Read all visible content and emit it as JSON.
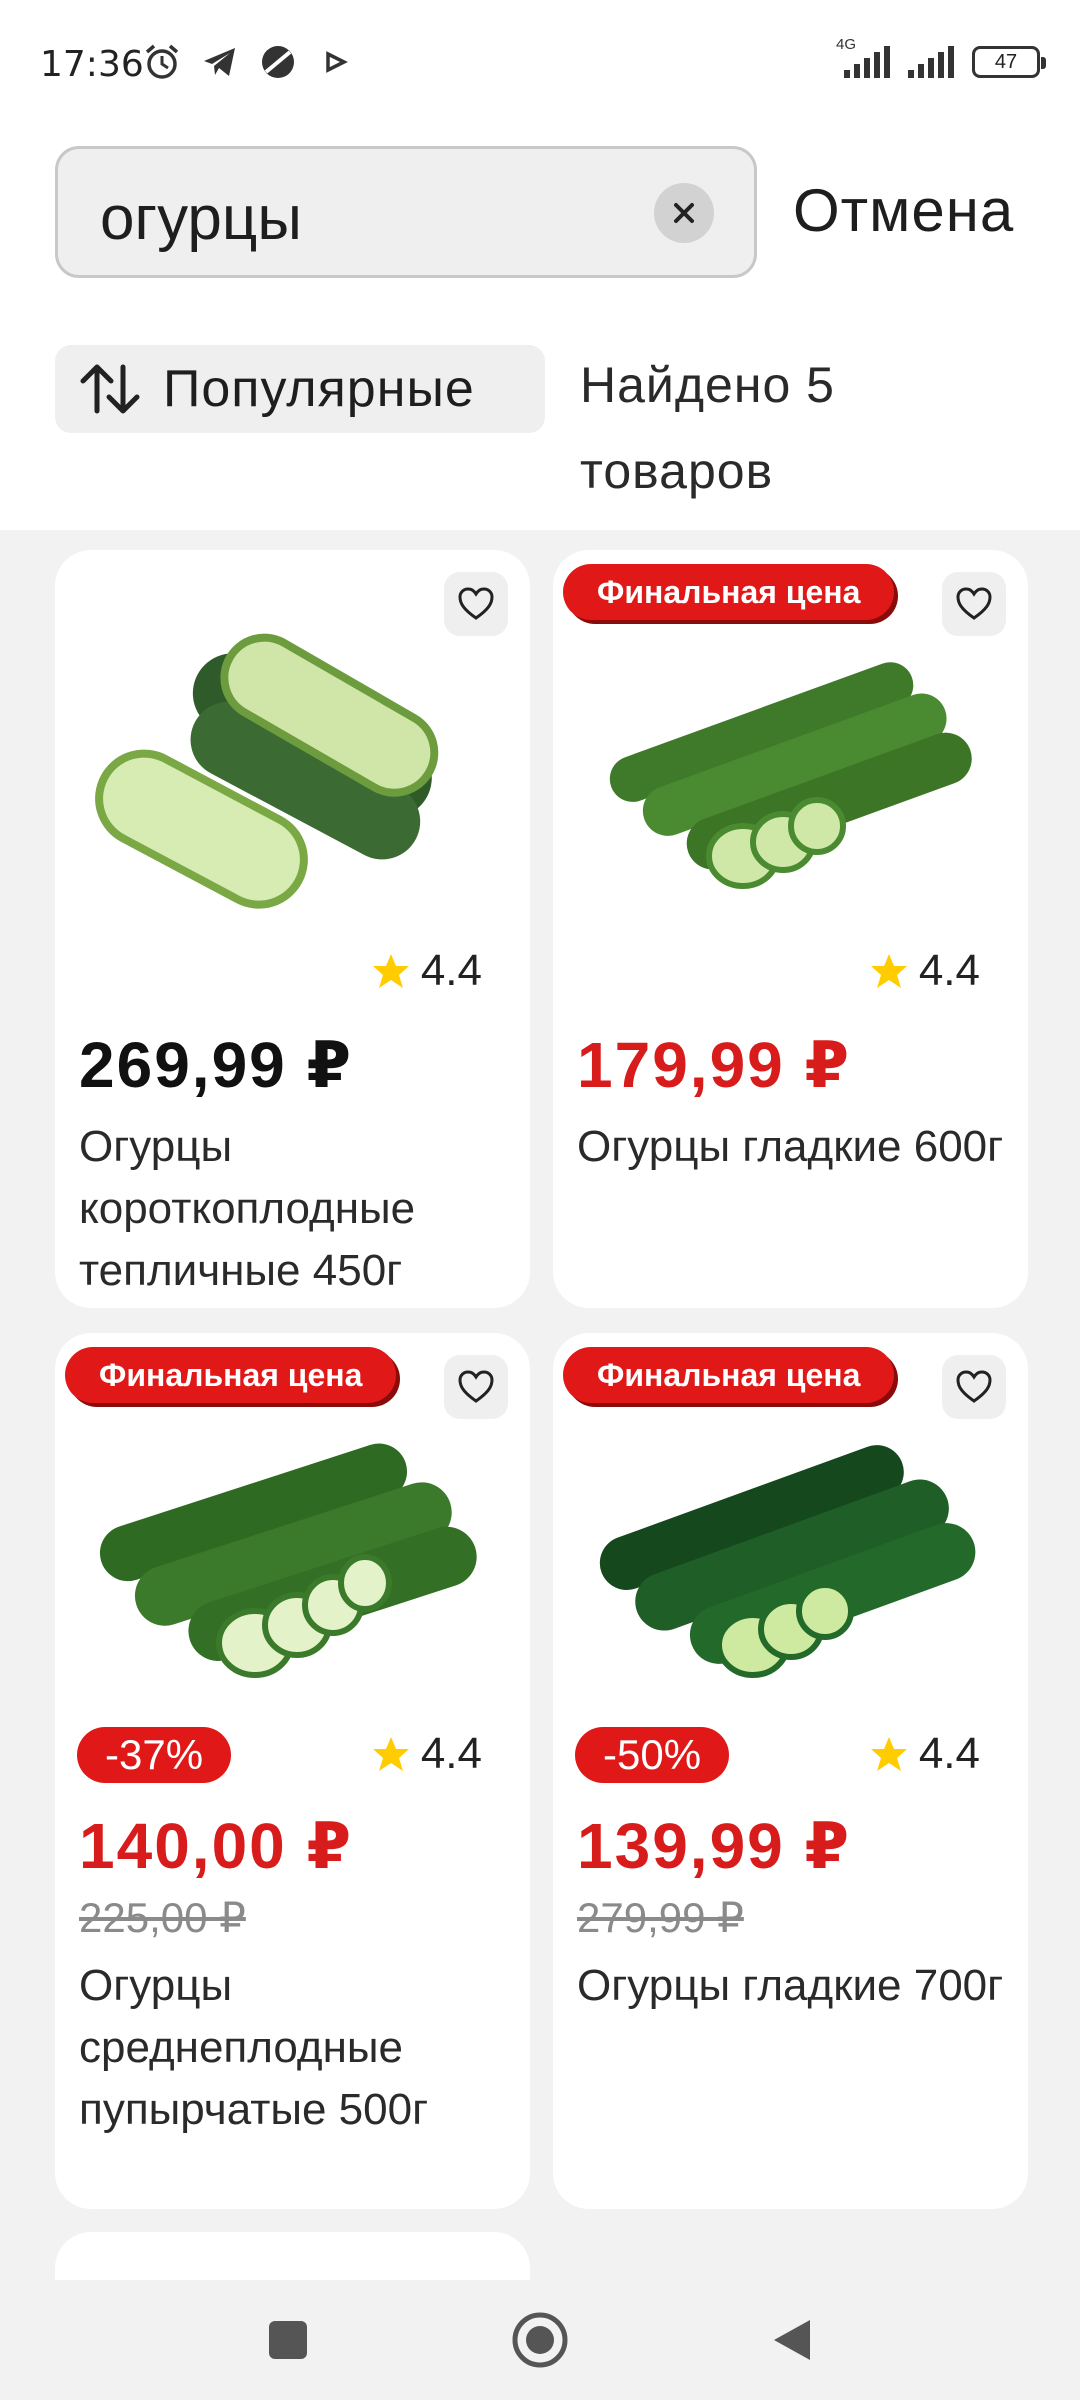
{
  "status_bar": {
    "time": "17:36",
    "network": "4G",
    "battery": "47",
    "icons": [
      "alarm-icon",
      "telegram-icon",
      "app-icon",
      "play-icon"
    ]
  },
  "search": {
    "query": "огурцы",
    "cancel_label": "Отмена"
  },
  "sort": {
    "label": "Популярные",
    "icon": "sort-arrows-icon"
  },
  "results": {
    "found_text": "Найдено 5 товаров"
  },
  "colors": {
    "accent_red": "#e01818",
    "price_red": "#d81c1c",
    "star_yellow": "#ffcc00"
  },
  "products": [
    {
      "name": "Огурцы короткоплодные тепличные 450г",
      "price": "269,99 ₽",
      "rating": "4.4",
      "badge": "",
      "discount": "",
      "old_price": ""
    },
    {
      "name": "Огурцы гладкие 600г",
      "price": "179,99 ₽",
      "rating": "4.4",
      "badge": "Финальная цена",
      "discount": "",
      "old_price": ""
    },
    {
      "name": "Огурцы среднеплодные пупырчатые 500г",
      "price": "140,00 ₽",
      "rating": "4.4",
      "badge": "Финальная цена",
      "discount": "-37%",
      "old_price": "225,00 ₽"
    },
    {
      "name": "Огурцы гладкие 700г",
      "price": "139,99 ₽",
      "rating": "4.4",
      "badge": "Финальная цена",
      "discount": "-50%",
      "old_price": "279,99 ₽"
    }
  ],
  "nav": {
    "icons": [
      "recent-apps-icon",
      "home-icon",
      "back-icon"
    ]
  }
}
